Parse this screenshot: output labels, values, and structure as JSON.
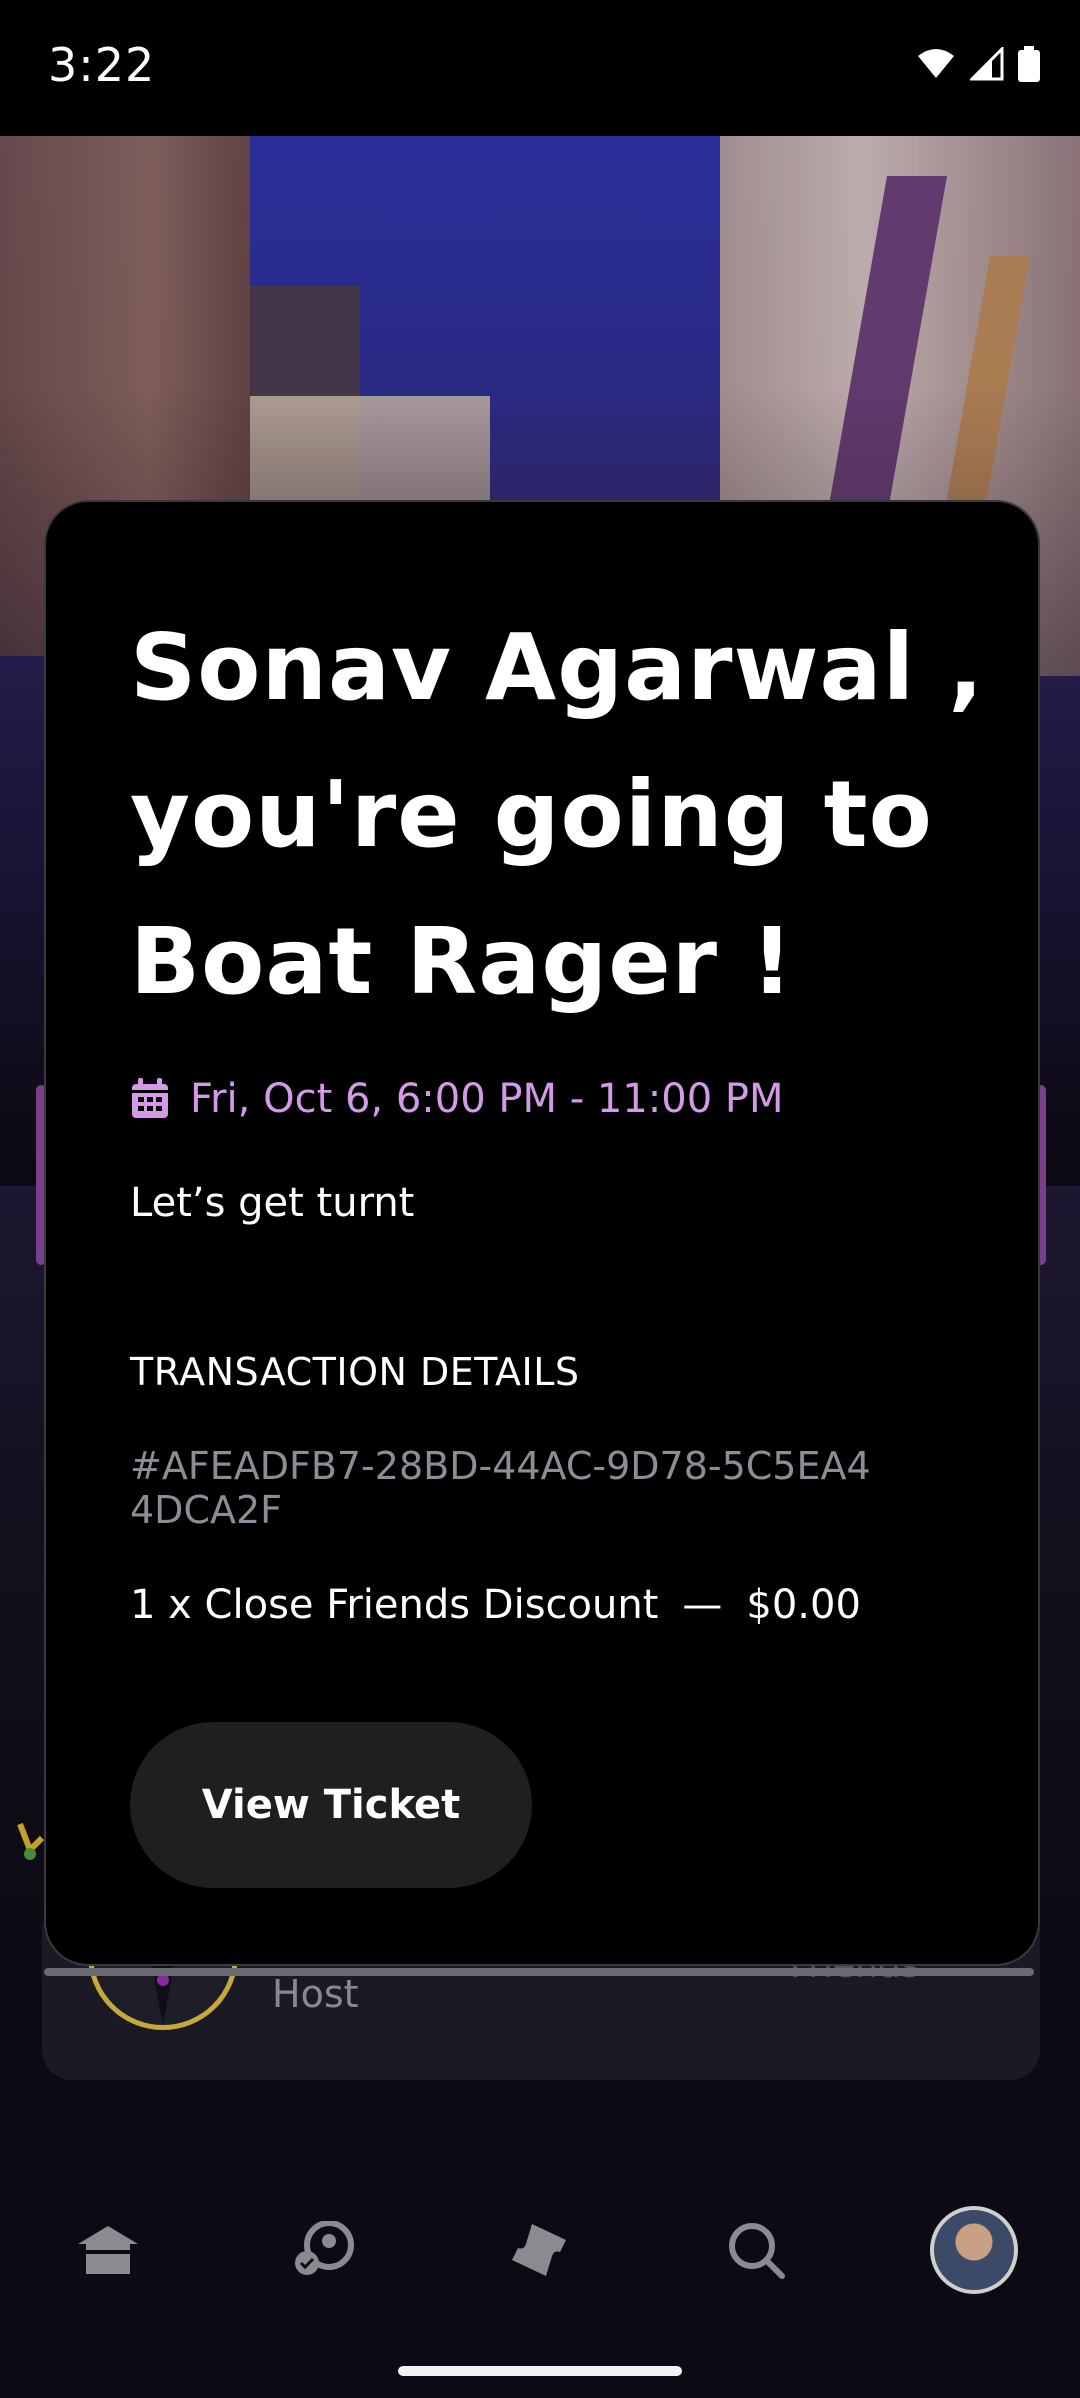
{
  "status_bar": {
    "time": "3:22"
  },
  "event": {
    "headline": "Sonav Agarwal , you're going to Boat Rager !",
    "datetime": "Fri, Oct 6, 6:00 PM - 11:00 PM",
    "description": "Let’s get turnt"
  },
  "transaction": {
    "heading": "TRANSACTION DETAILS",
    "id": "#AFEADFB7-28BD-44AC-9D78-5C5EA44DCA2F",
    "line_item": {
      "label": "1 x Close Friends Discount",
      "separator": "—",
      "price": "$0.00"
    }
  },
  "actions": {
    "view_ticket": "View Ticket"
  },
  "background_card": {
    "role": "Host",
    "friends": "Friends"
  },
  "bottom_nav": {
    "items": [
      "home-icon",
      "people-icon",
      "ticket-icon",
      "search-icon",
      "profile-avatar"
    ]
  },
  "colors": {
    "accent": "#d49ae8",
    "card_bg": "#000000",
    "button_bg": "#1f1f1f",
    "muted_text": "#8e8c96"
  }
}
